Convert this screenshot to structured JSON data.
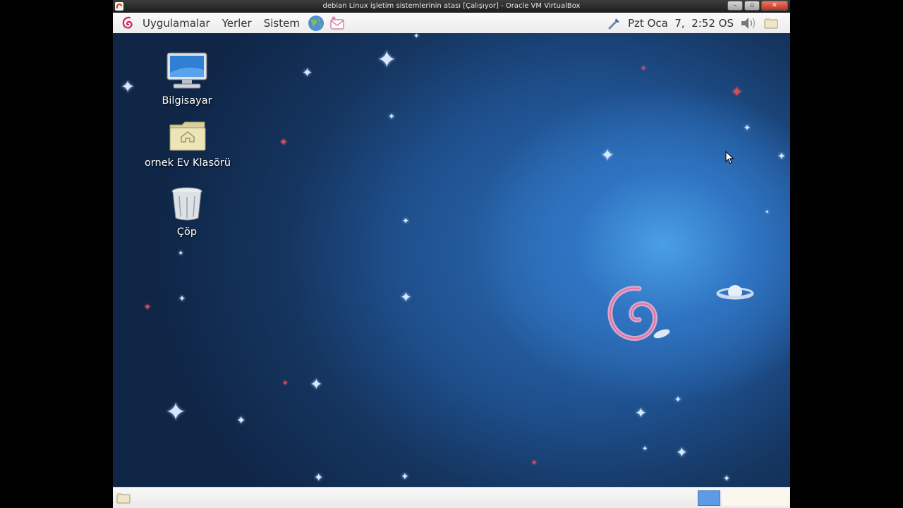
{
  "window": {
    "title": "debian Linux işletim sistemlerinin atası [Çalışıyor] - Oracle VM VirtualBox",
    "controls": [
      "minimize-icon",
      "restore-icon",
      "close-icon"
    ]
  },
  "top_panel": {
    "menus": [
      "Uygulamalar",
      "Yerler",
      "Sistem"
    ],
    "launchers": [
      "web-browser-icon",
      "mail-icon"
    ],
    "clock": "Pzt Oca  7,  2:52 OS",
    "tray": [
      "network-tool-icon",
      "volume-icon",
      "notification-icon"
    ]
  },
  "desktop": {
    "icons": [
      {
        "label": "Bilgisayar",
        "icon": "computer-icon"
      },
      {
        "label": "ornek Ev Klasörü",
        "icon": "home-folder-icon"
      },
      {
        "label": "Çöp",
        "icon": "trash-icon"
      }
    ],
    "wallpaper": "debian-space-swirl",
    "colors": {
      "accent": "#d1235c",
      "panel": "#f5f5f5",
      "sky_dark": "#0f2647",
      "sky_light": "#4a9fe6"
    }
  },
  "bottom_panel": {
    "items": [
      "show-desktop-icon",
      "workspace-switcher"
    ]
  }
}
